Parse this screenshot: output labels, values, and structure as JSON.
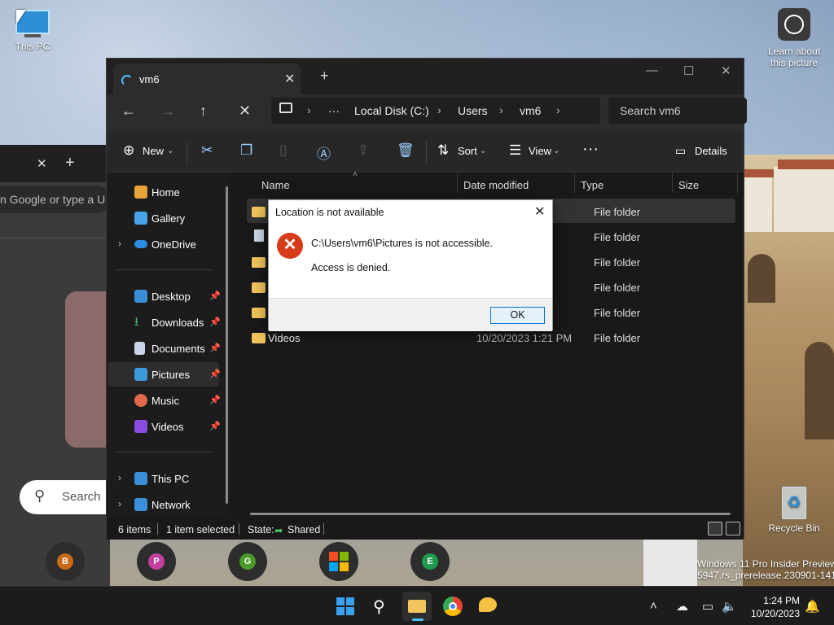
{
  "desktop": {
    "this_pc_label": "This PC",
    "learn_label_1": "Learn about",
    "learn_label_2": "this picture",
    "recycle_label": "Recycle Bin",
    "watermark_line1": "Windows 11 Pro Insider Preview",
    "watermark_line2": "5947.rs_prerelease.230901-1416"
  },
  "browser": {
    "address_placeholder": "n Google or type a URL",
    "search_label": "Search",
    "shortcuts": [
      {
        "letter": "B",
        "color": "#c86a18"
      },
      {
        "letter": "P",
        "color": "#c43fa0"
      },
      {
        "letter": "G",
        "color": "#4a9a2a"
      },
      {
        "letter": "",
        "color": "#f25022"
      },
      {
        "letter": "E",
        "color": "#1f9a4f"
      }
    ]
  },
  "explorer": {
    "tab_title": "vm6",
    "breadcrumb": [
      "Local Disk (C:)",
      "Users",
      "vm6"
    ],
    "search_placeholder": "Search vm6",
    "commands": {
      "new": "New",
      "sort": "Sort",
      "view": "View",
      "details": "Details"
    },
    "sidebar": [
      {
        "label": "Home",
        "color": "#e8a23a",
        "pinned": false,
        "expandable": false
      },
      {
        "label": "Gallery",
        "color": "#4aa3e8",
        "pinned": false,
        "expandable": false
      },
      {
        "label": "OneDrive",
        "color": "#2b8de0",
        "pinned": false,
        "expandable": true
      },
      {
        "label": "Desktop",
        "color": "#3a8fd8",
        "pinned": true,
        "expandable": false
      },
      {
        "label": "Downloads",
        "color": "#3dbb6a",
        "pinned": true,
        "expandable": false
      },
      {
        "label": "Documents",
        "color": "#c9d6e8",
        "pinned": true,
        "expandable": false
      },
      {
        "label": "Pictures",
        "color": "#3b9bd9",
        "pinned": true,
        "expandable": false,
        "selected": true
      },
      {
        "label": "Music",
        "color": "#e26a4a",
        "pinned": true,
        "expandable": false
      },
      {
        "label": "Videos",
        "color": "#8a4de0",
        "pinned": true,
        "expandable": false
      },
      {
        "label": "This PC",
        "color": "#3a8fd8",
        "pinned": false,
        "expandable": true
      },
      {
        "label": "Network",
        "color": "#3a8fd8",
        "pinned": false,
        "expandable": true
      }
    ],
    "columns": [
      "Name",
      "Date modified",
      "Type",
      "Size"
    ],
    "rows": [
      {
        "name": "",
        "date": "",
        "type": "File folder",
        "icon": "folder",
        "selected": true
      },
      {
        "name": "",
        "date": "",
        "type": "File folder",
        "icon": "doc"
      },
      {
        "name": "",
        "date": "",
        "type": "File folder",
        "icon": "folder"
      },
      {
        "name": "",
        "date": "",
        "type": "File folder",
        "icon": "folder"
      },
      {
        "name": "",
        "date": "",
        "type": "File folder",
        "icon": "folder"
      },
      {
        "name": "Videos",
        "date": "10/20/2023 1:21 PM",
        "type": "File folder",
        "icon": "folder"
      }
    ],
    "status": {
      "items": "6 items",
      "selected": "1 item selected",
      "state_label": "State:",
      "state_value": "Shared"
    }
  },
  "dialog": {
    "title": "Location is not available",
    "message": "C:\\Users\\vm6\\Pictures is not accessible.",
    "detail": "Access is denied.",
    "ok_label": "OK"
  },
  "taskbar": {
    "time": "1:24 PM",
    "date": "10/20/2023"
  }
}
